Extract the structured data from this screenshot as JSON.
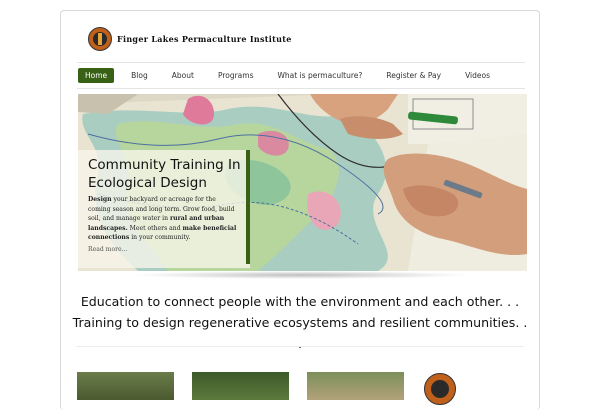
{
  "site": {
    "title": "Finger Lakes Permaculture Institute"
  },
  "nav": {
    "items": [
      {
        "label": "Home",
        "active": true
      },
      {
        "label": "Blog"
      },
      {
        "label": "About"
      },
      {
        "label": "Programs"
      },
      {
        "label": "What is permaculture?"
      },
      {
        "label": "Register & Pay"
      },
      {
        "label": "Videos"
      }
    ]
  },
  "hero": {
    "title": "Community Training In Ecological Design",
    "text_parts": {
      "p1_bold": "Design",
      "p1": " your backyard or acreage for the coming season and long term. Grow food, build soil, and manage water in ",
      "p2_bold": "rural and urban landscapes.",
      "p2": " Meet others and ",
      "p3_bold": "make beneficial connections",
      "p3": " in your community."
    },
    "read_more": "Read more..."
  },
  "tagline": "Education to connect people with the environment and each other. . . Training to design regenerative ecosystems and resilient communities. . .",
  "colors": {
    "accent": "#386116",
    "hero_overlay": "#f8f6eb"
  },
  "icons": {
    "logo": "permaculture-tree-logo"
  }
}
